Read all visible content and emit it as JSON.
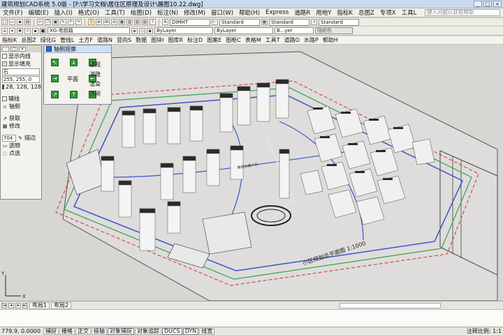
{
  "app": {
    "title": "建筑规划CAD系统 5.0版 - [F:\\学习文档\\居住区原理及设计\\展图10.22.dwg]"
  },
  "menu": [
    "文件(F)",
    "编辑(E)",
    "插入(I)",
    "格式(O)",
    "工具(T)",
    "绘图(D)",
    "标注(N)",
    "修改(M)",
    "窗口(W)",
    "帮助(H)",
    "Express",
    "道路R",
    "用地Y",
    "指标K",
    "总图Z",
    "专项X",
    "工具L"
  ],
  "help_search": {
    "placeholder": "键入问题以获取帮助"
  },
  "toolbar1": {
    "dim_style": "DIMHT",
    "text_style": "Standard",
    "table_style": "Standard",
    "extra_style": "Standard"
  },
  "toolbar2": {
    "layer": "XG-宅前路",
    "color": "ByLayer",
    "linetype": "ByLayer",
    "lineweight": "B...yer",
    "plotstyle": "随颜色"
  },
  "menu2": [
    "指标K",
    "总图Z",
    "绿化G",
    "管线L",
    "土方F",
    "道路N",
    "竖向S",
    "数据",
    "图块I",
    "图库R",
    "标注D",
    "图案E",
    "图框C",
    "表格M",
    "工具T",
    "道路O",
    "水路P",
    "帮助H"
  ],
  "left_panel": {
    "opt1": "显示内线",
    "opt2": "显示填充",
    "opt2_checked": true,
    "color1": "255, 255, 0",
    "color2": "28, 128, 128",
    "btn_line": "辅线",
    "btn_axis": "轴侧",
    "btn_get": "获取",
    "btn_edit": "修改",
    "number": "704",
    "btn_trace": "描边",
    "btn_select": "选物",
    "btn_point": "点选",
    "row0": "石"
  },
  "axo_panel": {
    "title": "轴侧观察",
    "buttons": [
      "透视",
      "消隐",
      "渲染",
      "关闭"
    ],
    "center": "平面"
  },
  "drawing": {
    "label1": "小区规划总平面图 1:1000",
    "label2": "景观大道入口"
  },
  "tabs": [
    "布局1",
    "布局2"
  ],
  "status": {
    "coord": "779.9, 0.0000",
    "buttons": [
      "捕捉",
      "栅格",
      "正交",
      "极轴",
      "对象捕捉",
      "对象追踪",
      "DUCS",
      "DYN",
      "线宽"
    ],
    "right": "注释比例: 1:1"
  },
  "colors": {
    "canvas": "#d6d6d2",
    "building_roof": "#2a2a2a",
    "road_blue": "#3a55c8",
    "site_green": "#38a048",
    "boundary_red": "#d03030",
    "green_arrow": "#2f9a34"
  }
}
